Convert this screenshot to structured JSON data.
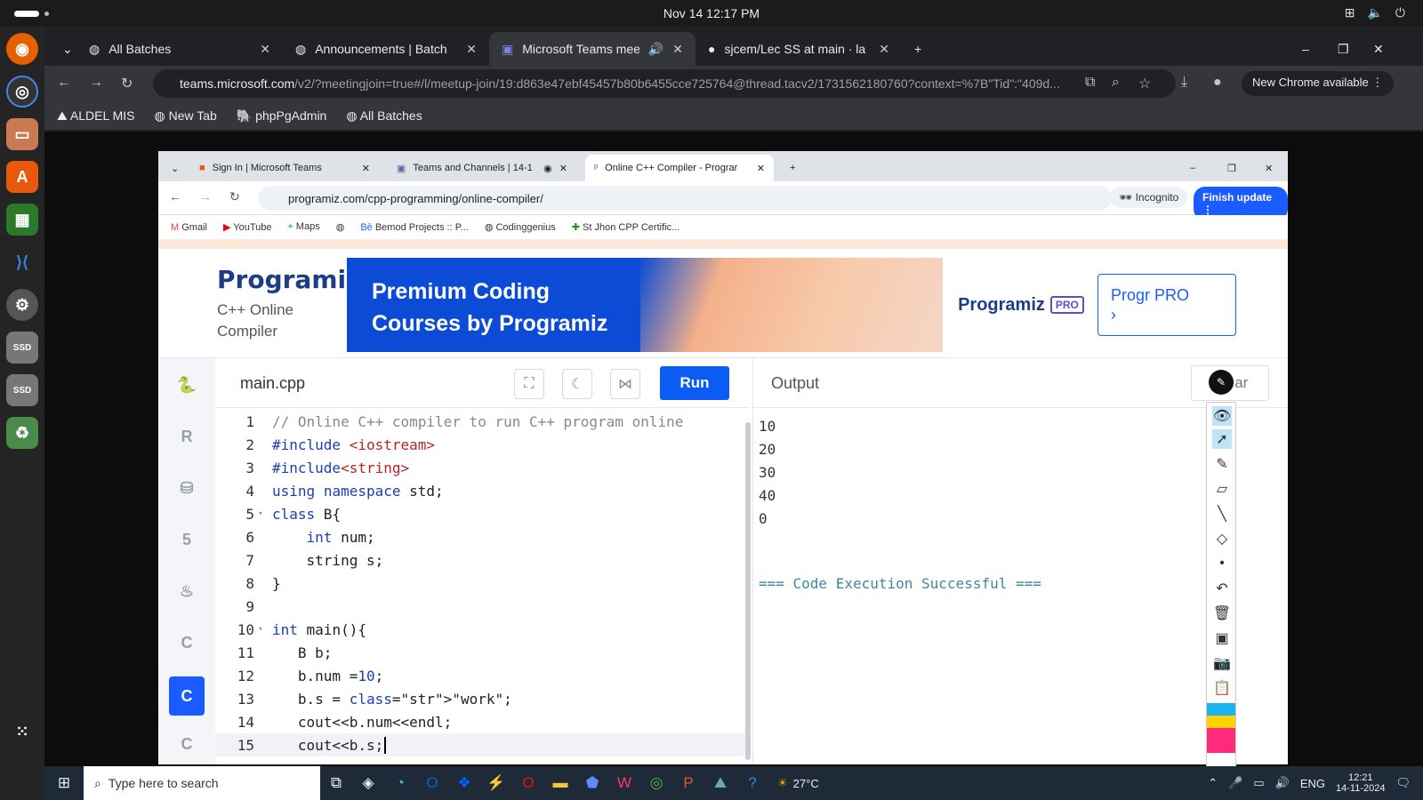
{
  "os": {
    "clock": "Nov 14  12:17 PM"
  },
  "chrome": {
    "tabs": [
      {
        "label": "All Batches",
        "icon": "globe-icon"
      },
      {
        "label": "Announcements | Batch",
        "icon": "globe-icon"
      },
      {
        "label": "Microsoft Teams mee",
        "icon": "teams-icon"
      },
      {
        "label": "sjcem/Lec SS at main · la",
        "icon": "github-icon"
      }
    ],
    "url_host": "teams.microsoft.com",
    "url_rest": "/v2/?meetingjoin=true#/l/meetup-join/19:d863e47ebf45457b80b6455cce725764@thread.tacv2/1731562180760?context=%7B\"Tid\":\"409d...",
    "new_chrome": "New Chrome available",
    "bookmarks": [
      "ALDEL MIS",
      "New Tab",
      "phpPgAdmin",
      "All Batches"
    ]
  },
  "inner": {
    "tabs": [
      "Sign In | Microsoft Teams",
      "Teams and Channels | 14-1",
      "Online C++ Compiler - Prograr"
    ],
    "url": "programiz.com/cpp-programming/online-compiler/",
    "incognito": "Incognito",
    "finish_update": "Finish update",
    "bookmarks": [
      "Gmail",
      "YouTube",
      "Maps",
      "Bemod Projects :: P...",
      "Codinggenius",
      "St Jhon CPP Certific..."
    ]
  },
  "page": {
    "brand": "Programiz",
    "subtitle_1": "C++ Online",
    "subtitle_2": "Compiler",
    "banner_line1": "Premium Coding",
    "banner_line2": "Courses by Programiz",
    "banner_brand": "Programiz",
    "banner_pro": "PRO",
    "pro_button": "Progr    PRO",
    "filename": "main.cpp",
    "run": "Run",
    "output_title": "Output",
    "clear": "Clear",
    "output_lines": [
      "10",
      "20",
      "30",
      "40",
      "0"
    ],
    "output_status": "=== Code Execution Successful ==="
  },
  "code": [
    {
      "n": "1",
      "t": "// Online C++ compiler to run C++ program online"
    },
    {
      "n": "2",
      "t": "#include <iostream>"
    },
    {
      "n": "3",
      "t": "#include<string>"
    },
    {
      "n": "4",
      "t": "using namespace std;"
    },
    {
      "n": "5",
      "t": "class B{"
    },
    {
      "n": "6",
      "t": "    int num;"
    },
    {
      "n": "7",
      "t": "    string s;"
    },
    {
      "n": "8",
      "t": "}"
    },
    {
      "n": "9",
      "t": ""
    },
    {
      "n": "10",
      "t": "int main(){"
    },
    {
      "n": "11",
      "t": "   B b;"
    },
    {
      "n": "12",
      "t": "   b.num =10;"
    },
    {
      "n": "13",
      "t": "   b.s = \"work\";"
    },
    {
      "n": "14",
      "t": "   cout<<b.num<<endl;"
    },
    {
      "n": "15",
      "t": "   cout<<b.s;"
    }
  ],
  "taskbar": {
    "search": "Type here to search",
    "weather": "27°C",
    "lang": "ENG",
    "time": "12:21",
    "date": "14-11-2024"
  }
}
